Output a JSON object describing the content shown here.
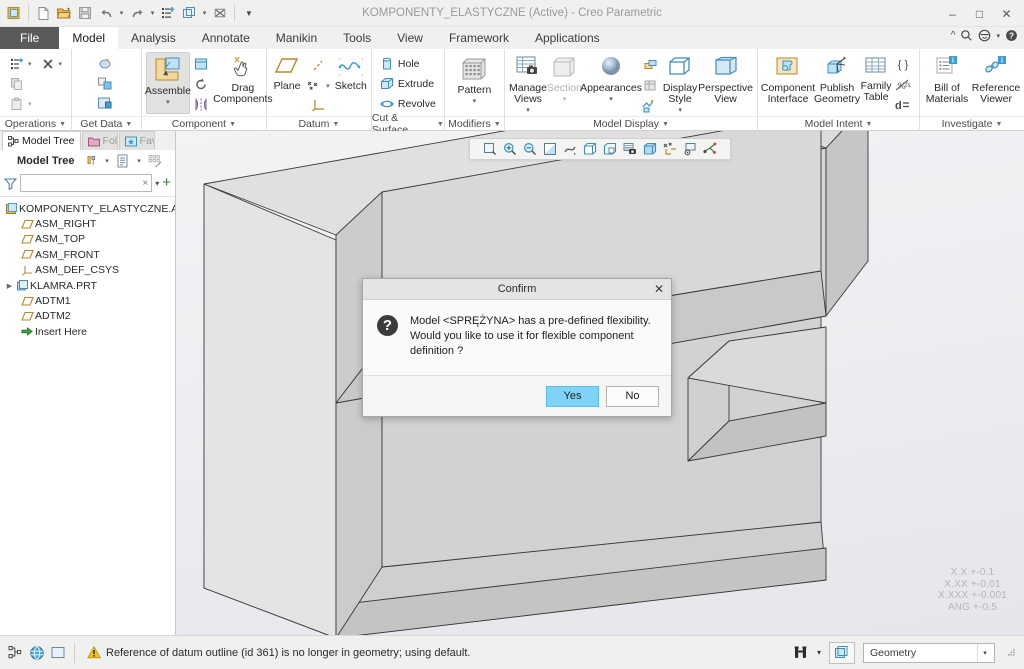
{
  "window": {
    "title": "KOMPONENTY_ELASTYCZNE (Active) - Creo Parametric",
    "minimize": "–",
    "maximize": "□",
    "close": "✕"
  },
  "quick_access": [
    {
      "name": "creo-logo-icon",
      "tip": "Creo Parametric"
    },
    {
      "name": "new-icon",
      "tip": "New"
    },
    {
      "name": "open-icon",
      "tip": "Open"
    },
    {
      "name": "save-icon",
      "tip": "Save"
    },
    {
      "name": "undo-icon",
      "tip": "Undo"
    },
    {
      "name": "redo-icon",
      "tip": "Redo"
    },
    {
      "name": "regenerate-icon",
      "tip": "Regenerate"
    },
    {
      "name": "window-icon",
      "tip": "Window"
    },
    {
      "name": "close-window-icon",
      "tip": "Close"
    },
    {
      "name": "customize-qat-icon",
      "tip": "Customize Quick Access Toolbar"
    }
  ],
  "tabs": [
    {
      "label": "File",
      "type": "file"
    },
    {
      "label": "Model",
      "type": "active"
    },
    {
      "label": "Analysis",
      "type": "normal"
    },
    {
      "label": "Annotate",
      "type": "normal"
    },
    {
      "label": "Manikin",
      "type": "normal"
    },
    {
      "label": "Tools",
      "type": "normal"
    },
    {
      "label": "View",
      "type": "normal"
    },
    {
      "label": "Framework",
      "type": "normal"
    },
    {
      "label": "Applications",
      "type": "normal"
    }
  ],
  "tab_right_icons": [
    {
      "name": "collapse-ribbon-icon"
    },
    {
      "name": "search-icon"
    },
    {
      "name": "account-icon"
    },
    {
      "name": "account-dropdown-icon"
    },
    {
      "name": "help-icon"
    }
  ],
  "ribbon": {
    "groups": [
      {
        "label": "Operations",
        "small_items": [
          {
            "label": "",
            "icon": "regenerate-icon",
            "dim": false,
            "dropdown": true
          },
          {
            "label": "",
            "icon": "delete-icon",
            "dim": false,
            "dropdown": true
          },
          {
            "label": "",
            "icon": "copy-icon",
            "dim": true,
            "dropdown": false
          },
          {
            "label": "",
            "icon": "paste-icon",
            "dim": true,
            "dropdown": true
          }
        ]
      },
      {
        "label": "Get Data",
        "small_items": [
          {
            "label": "",
            "icon": "import-icon"
          },
          {
            "label": "",
            "icon": "merge-icon"
          },
          {
            "label": "",
            "icon": "shrinkwrap-icon"
          }
        ]
      },
      {
        "label": "Component",
        "big_items": [
          {
            "label": "Assemble",
            "icon": "assemble-icon",
            "selected": true,
            "dropdown": true
          },
          {
            "label": "Drag Components",
            "icon": "drag-components-icon",
            "selected": false,
            "dropdown": false
          }
        ],
        "small_items": [
          {
            "label": "",
            "icon": "create-component-icon"
          },
          {
            "label": "",
            "icon": "repeat-icon"
          },
          {
            "label": "",
            "icon": "mirror-component-icon"
          }
        ]
      },
      {
        "label": "Datum",
        "big_items": [
          {
            "label": "Plane",
            "icon": "datum-plane-icon"
          },
          {
            "label": "Sketch",
            "icon": "sketch-icon"
          }
        ],
        "small_items": [
          {
            "label": "",
            "icon": "datum-axis-icon"
          },
          {
            "label": "",
            "icon": "datum-point-icon",
            "dropdown": true
          },
          {
            "label": "",
            "icon": "coordinate-system-icon"
          }
        ]
      },
      {
        "label": "Cut & Surface",
        "small_items": [
          {
            "label": "Hole",
            "icon": "hole-icon"
          },
          {
            "label": "Extrude",
            "icon": "extrude-icon"
          },
          {
            "label": "Revolve",
            "icon": "revolve-icon"
          }
        ]
      },
      {
        "label": "Modifiers",
        "big_items": [
          {
            "label": "Pattern",
            "icon": "pattern-icon",
            "dropdown": true
          }
        ]
      },
      {
        "label": "Model Display",
        "big_items": [
          {
            "label": "Manage Views",
            "icon": "manage-views-icon",
            "dropdown": true
          },
          {
            "label": "Section",
            "icon": "section-icon",
            "dropdown": true,
            "dim": true
          },
          {
            "label": "Appearances",
            "icon": "appearances-icon",
            "dropdown": true
          },
          {
            "label": "Display Style",
            "icon": "display-style-icon",
            "dropdown": true
          },
          {
            "label": "Perspective View",
            "icon": "perspective-view-icon"
          }
        ],
        "small_items": [
          {
            "label": "",
            "icon": "layers-icon"
          },
          {
            "label": "",
            "icon": "explode-icon"
          },
          {
            "label": "",
            "icon": "model-setup-icon"
          }
        ]
      },
      {
        "label": "Model Intent",
        "big_items": [
          {
            "label": "Component Interface",
            "icon": "component-interface-icon"
          },
          {
            "label": "Publish Geometry",
            "icon": "publish-geometry-icon"
          },
          {
            "label": "Family Table",
            "icon": "family-table-icon"
          }
        ],
        "small_items": [
          {
            "label": "",
            "icon": "parameters-icon"
          },
          {
            "label": "",
            "icon": "relations-icon"
          },
          {
            "label": "",
            "icon": "switch-dimensions-icon"
          }
        ]
      },
      {
        "label": "Investigate",
        "big_items": [
          {
            "label": "Bill of Materials",
            "icon": "bill-of-materials-icon"
          },
          {
            "label": "Reference Viewer",
            "icon": "reference-viewer-icon"
          }
        ]
      }
    ]
  },
  "left_panel": {
    "tabs": [
      {
        "label": "Model Tree",
        "icon": "model-tree-icon",
        "active": true
      },
      {
        "label": "Fold",
        "icon": "folder-browser-icon",
        "active": false
      },
      {
        "label": "Fav",
        "icon": "favorites-icon",
        "active": false
      }
    ],
    "toolbar_title": "Model Tree",
    "toolbar_icons": [
      {
        "name": "settings-tools-icon",
        "dropdown": true
      },
      {
        "name": "display-options-icon",
        "dropdown": true
      },
      {
        "name": "tree-columns-icon",
        "dropdown": false
      }
    ],
    "filter": {
      "value": "",
      "placeholder": "",
      "icon": "filter-icon",
      "clear_icon": "×",
      "dropdown_icon": "▾",
      "add_icon": "+"
    },
    "tree": [
      {
        "label": "KOMPONENTY_ELASTYCZNE.ASM",
        "icon": "assembly-icon",
        "depth": 0,
        "expandable": false
      },
      {
        "label": "ASM_RIGHT",
        "icon": "datum-plane-icon",
        "depth": 1,
        "expandable": false
      },
      {
        "label": "ASM_TOP",
        "icon": "datum-plane-icon",
        "depth": 1,
        "expandable": false
      },
      {
        "label": "ASM_FRONT",
        "icon": "datum-plane-icon",
        "depth": 1,
        "expandable": false
      },
      {
        "label": "ASM_DEF_CSYS",
        "icon": "coordinate-system-icon",
        "depth": 1,
        "expandable": false
      },
      {
        "label": "KLAMRA.PRT",
        "icon": "part-icon",
        "depth": 1,
        "expandable": true
      },
      {
        "label": "ADTM1",
        "icon": "datum-plane-icon",
        "depth": 1,
        "expandable": false
      },
      {
        "label": "ADTM2",
        "icon": "datum-plane-icon",
        "depth": 1,
        "expandable": false
      },
      {
        "label": "Insert Here",
        "icon": "insert-here-icon",
        "depth": 1,
        "expandable": false
      }
    ]
  },
  "graphics_toolbar": [
    {
      "name": "refit-icon"
    },
    {
      "name": "zoom-in-icon"
    },
    {
      "name": "zoom-out-icon"
    },
    {
      "name": "repaint-icon"
    },
    {
      "name": "spin-center-icon"
    },
    {
      "name": "display-style-icon"
    },
    {
      "name": "saved-orientations-icon"
    },
    {
      "name": "view-manager-icon"
    },
    {
      "name": "perspective-icon"
    },
    {
      "name": "datum-display-filters-icon"
    },
    {
      "name": "annotation-display-icon"
    },
    {
      "name": "spin-center-toggle-icon"
    }
  ],
  "viewport": {
    "tolerance_note": [
      "X.X +-0.1",
      "X.XX +-0.01",
      "X.XXX +-0.001",
      "ANG +-0.5"
    ]
  },
  "dialog": {
    "title": "Confirm",
    "close_label": "✕",
    "icon": "question-icon",
    "icon_glyph": "?",
    "message_line1": "Model <SPRĘŻYNA> has a pre-defined flexibility.",
    "message_line2": "Would you like to use it for flexible component definition ?",
    "buttons": [
      {
        "label": "Yes",
        "primary": true
      },
      {
        "label": "No",
        "primary": false
      }
    ]
  },
  "status_bar": {
    "left_icons": [
      {
        "name": "model-tree-toggle-icon"
      },
      {
        "name": "web-browser-toggle-icon"
      },
      {
        "name": "navigator-toggle-icon"
      }
    ],
    "warning_icon": "warning-icon",
    "message": "Reference of datum outline (id 361) is no longer in geometry; using default.",
    "right_icons": [
      {
        "name": "search-binoculars-icon",
        "dropdown": true
      },
      {
        "name": "selection-box-icon"
      }
    ],
    "filter_select": {
      "value": "Geometry",
      "arrow": "▾"
    }
  },
  "colors": {
    "accent_blue": "#7fd3f7",
    "ribbon_bg": "#ffffff",
    "chrome_bg": "#f0f0ef",
    "file_tab": "#5a5a58",
    "icon_blue": "#3f9cd1",
    "icon_gold": "#d9a441",
    "warning_yellow": "#f5c116",
    "model_face": "#d4d4d4"
  }
}
